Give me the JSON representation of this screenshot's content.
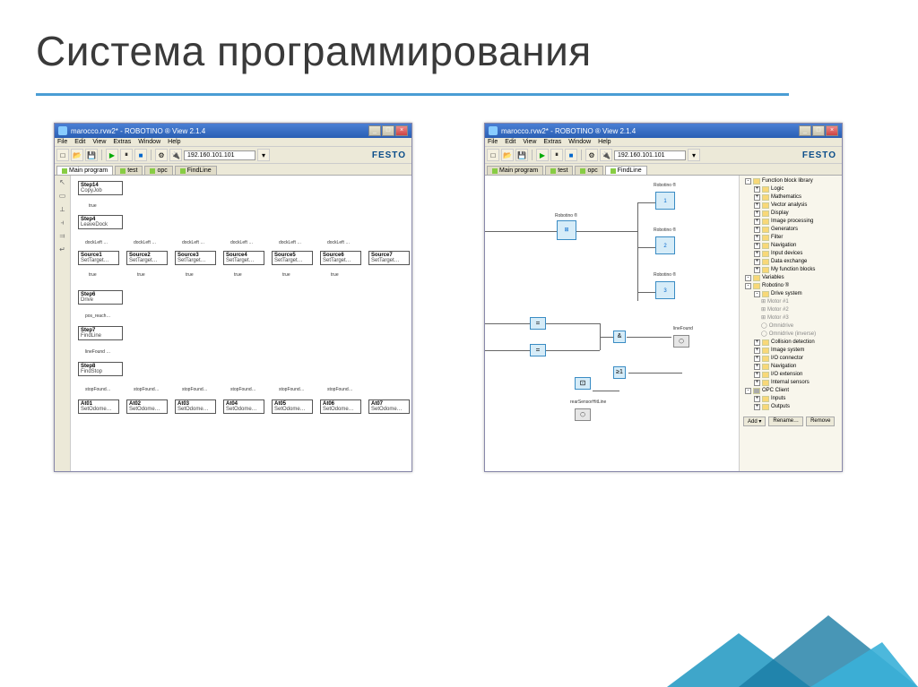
{
  "slide": {
    "title": "Система программирования"
  },
  "win1": {
    "title": "marocco.rvw2* - ROBOTINO ® View 2.1.4",
    "menu": [
      "File",
      "Edit",
      "View",
      "Extras",
      "Window",
      "Help"
    ],
    "ip": "192.160.101.101",
    "logo": "FESTO",
    "tabs": [
      "Main program",
      "test",
      "opc",
      "FindLine"
    ],
    "steps": [
      {
        "t": "Step14",
        "s": "CopyJob"
      },
      {
        "t": "Step4",
        "s": "LeaveDock"
      },
      {
        "t": "Step6",
        "s": "Drive"
      },
      {
        "t": "Step7",
        "s": "FindLine"
      },
      {
        "t": "Step8",
        "s": "FindStop"
      }
    ],
    "sources": [
      "Source1",
      "Source2",
      "Source3",
      "Source4",
      "Source5",
      "Source6",
      "Source7"
    ],
    "source_sub": "SetTarget…",
    "ats": [
      "At01",
      "At02",
      "At03",
      "At04",
      "At05",
      "At06",
      "At07"
    ],
    "at_sub": "SetOdome…",
    "labels": {
      "true": "true",
      "dockLeft": "dockLeft …",
      "posReach": "pos_reach…",
      "lineFound": "lineFound …",
      "stopFound": "stopFound…"
    }
  },
  "win2": {
    "title": "marocco.rvw2* - ROBOTINO ® View 2.1.4",
    "menu": [
      "File",
      "Edit",
      "View",
      "Extras",
      "Window",
      "Help"
    ],
    "ip": "192.160.101.101",
    "logo": "FESTO",
    "tabs": [
      "Main program",
      "test",
      "opc",
      "FindLine"
    ],
    "nodes": {
      "robotino": "Robotino ®",
      "lineFound": "lineFound",
      "rear": "rearSensorHitLine"
    },
    "robotino_nums": [
      "1",
      "2",
      "3"
    ],
    "tree": {
      "root": "Function block library",
      "items": [
        "Logic",
        "Mathematics",
        "Vector analysis",
        "Display",
        "Image processing",
        "Generators",
        "Filter",
        "Navigation",
        "Input devices",
        "Data exchange",
        "My function blocks"
      ],
      "variables": "Variables",
      "robotino": "Robotino ®",
      "drive": "Drive system",
      "motors": [
        "Motor #1",
        "Motor #2",
        "Motor #3"
      ],
      "drive_items": [
        "Omnidrive",
        "Omnidrive (inverse)"
      ],
      "robo_items": [
        "Collision detection",
        "Image system",
        "I/O connector",
        "Navigation",
        "I/O extension",
        "Internal sensors"
      ],
      "opc": "OPC Client",
      "inputs": "Inputs",
      "outputs": "Outputs"
    },
    "buttons": {
      "add": "Add",
      "rename": "Rename…",
      "remove": "Remove"
    }
  }
}
